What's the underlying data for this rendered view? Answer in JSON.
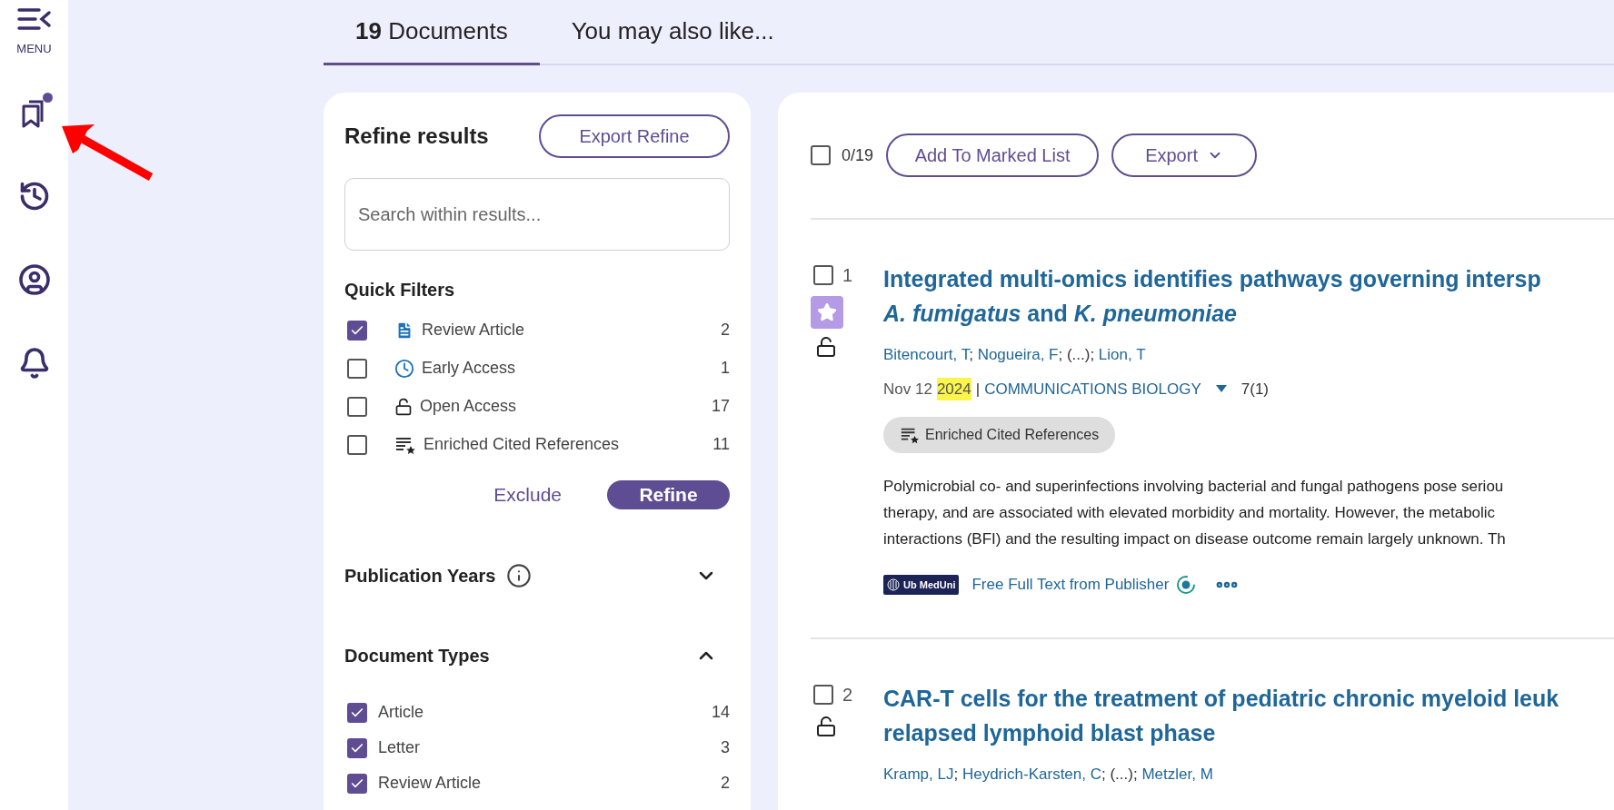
{
  "sidebar": {
    "menu_label": "MENU",
    "items": [
      {
        "kind": "marked",
        "dot": true
      },
      {
        "kind": "history",
        "dot": false
      },
      {
        "kind": "profile",
        "dot": false
      },
      {
        "kind": "alerts",
        "dot": false
      }
    ]
  },
  "tabs": [
    {
      "label": "**19** Documents",
      "selected": true
    },
    {
      "label": "You may also like...",
      "selected": false
    }
  ],
  "refine": {
    "title": "Refine results",
    "export_button": "Export Refine",
    "search": {
      "placeholder": "Search within results..."
    },
    "quick_filters": {
      "title": "Quick Filters",
      "items": [
        {
          "kind": "review",
          "label": "Review Article",
          "count": "2",
          "checked": true
        },
        {
          "kind": "early",
          "label": "Early Access",
          "count": "1",
          "checked": false
        },
        {
          "kind": "open",
          "label": "Open Access",
          "count": "17",
          "checked": false
        },
        {
          "kind": "enriched",
          "label": "Enriched Cited References",
          "count": "11",
          "checked": false
        }
      ]
    },
    "exclude_button": "Exclude",
    "refine_button": "Refine",
    "sections": [
      {
        "title": "Publication Years",
        "info": true,
        "expanded": false
      },
      {
        "title": "Document Types",
        "info": false,
        "expanded": true,
        "items": [
          {
            "label": "Article",
            "count": "14",
            "checked": true
          },
          {
            "label": "Letter",
            "count": "3",
            "checked": true
          },
          {
            "label": "Review Article",
            "count": "2",
            "checked": true
          }
        ]
      }
    ]
  },
  "results": {
    "select_all": {
      "checked": false,
      "count": "0/19"
    },
    "add_button": "Add To Marked List",
    "export_button": "Export",
    "records": [
      {
        "number": "1",
        "checked": false,
        "starred": true,
        "open_access": true,
        "title_lines": [
          "Integrated multi-omics identifies pathways governing intersp",
          "*A. fumigatus* and *K. pneumoniae*"
        ],
        "authors": [
          {
            "kind": "link",
            "text": "Bitencourt, T"
          },
          {
            "kind": "text",
            "text": "; "
          },
          {
            "kind": "link",
            "text": "Nogueira, F"
          },
          {
            "kind": "text",
            "text": "; (...); "
          },
          {
            "kind": "link",
            "text": "Lion, T"
          }
        ],
        "date": "Nov 12",
        "year": "2024",
        "separator": "|",
        "journal": "COMMUNICATIONS BIOLOGY",
        "volume": "7(1)",
        "badge": "Enriched Cited References",
        "abstract_lines": [
          "Polymicrobial co- and superinfections involving bacterial and fungal pathogens pose seriou",
          "therapy, and are associated with elevated morbidity and mortality. However, the metabolic",
          "interactions (BFI) and the resulting impact on disease outcome remain largely unknown. Th"
        ],
        "logo": "Ub MedUni",
        "full_text_link": "Free Full Text from Publisher"
      },
      {
        "number": "2",
        "checked": false,
        "starred": false,
        "open_access": true,
        "title_lines": [
          "CAR-T cells for the treatment of pediatric chronic myeloid leuk",
          "relapsed lymphoid blast phase"
        ],
        "authors": [
          {
            "kind": "link",
            "text": "Kramp, LJ"
          },
          {
            "kind": "text",
            "text": "; "
          },
          {
            "kind": "link",
            "text": "Heydrich-Karsten, C"
          },
          {
            "kind": "text",
            "text": "; (...); "
          },
          {
            "kind": "link",
            "text": "Metzler, M"
          }
        ]
      }
    ]
  }
}
